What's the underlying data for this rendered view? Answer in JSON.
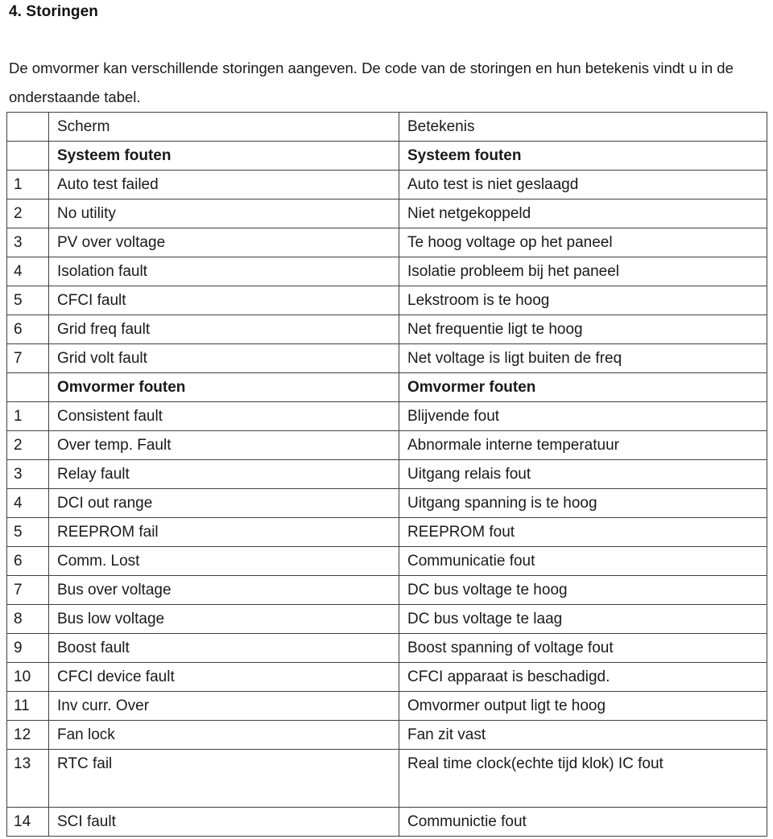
{
  "heading": "4. Storingen",
  "intro": "De omvormer kan verschillende storingen aangeven. De code van de storingen en hun betekenis vindt u in de onderstaande tabel.",
  "table": {
    "columns": {
      "num": "",
      "scherm": "Scherm",
      "betekenis": "Betekenis"
    },
    "rows": [
      {
        "num": "",
        "scherm": "Scherm",
        "betekenis": "Betekenis",
        "section": false,
        "tall": false
      },
      {
        "num": "",
        "scherm": "Systeem fouten",
        "betekenis": "Systeem fouten",
        "section": true,
        "tall": false
      },
      {
        "num": "1",
        "scherm": "Auto test failed",
        "betekenis": "Auto test is niet geslaagd",
        "section": false,
        "tall": false
      },
      {
        "num": "2",
        "scherm": "No utility",
        "betekenis": "Niet netgekoppeld",
        "section": false,
        "tall": false
      },
      {
        "num": "3",
        "scherm": "PV over voltage",
        "betekenis": "Te hoog voltage op het paneel",
        "section": false,
        "tall": false
      },
      {
        "num": "4",
        "scherm": "Isolation fault",
        "betekenis": "Isolatie probleem bij het paneel",
        "section": false,
        "tall": false
      },
      {
        "num": "5",
        "scherm": "CFCI fault",
        "betekenis": "Lekstroom is te hoog",
        "section": false,
        "tall": false
      },
      {
        "num": "6",
        "scherm": "Grid freq fault",
        "betekenis": "Net frequentie ligt te hoog",
        "section": false,
        "tall": false
      },
      {
        "num": "7",
        "scherm": "Grid volt fault",
        "betekenis": "Net voltage is ligt buiten de freq",
        "section": false,
        "tall": false
      },
      {
        "num": "",
        "scherm": "Omvormer fouten",
        "betekenis": "Omvormer fouten",
        "section": true,
        "tall": false
      },
      {
        "num": "1",
        "scherm": "Consistent fault",
        "betekenis": "Blijvende fout",
        "section": false,
        "tall": false
      },
      {
        "num": "2",
        "scherm": "Over temp. Fault",
        "betekenis": "Abnormale interne temperatuur",
        "section": false,
        "tall": false
      },
      {
        "num": "3",
        "scherm": "Relay fault",
        "betekenis": "Uitgang relais fout",
        "section": false,
        "tall": false
      },
      {
        "num": "4",
        "scherm": "DCI out range",
        "betekenis": "Uitgang spanning is te hoog",
        "section": false,
        "tall": false
      },
      {
        "num": "5",
        "scherm": "REEPROM fail",
        "betekenis": "REEPROM fout",
        "section": false,
        "tall": false
      },
      {
        "num": "6",
        "scherm": "Comm. Lost",
        "betekenis": "Communicatie fout",
        "section": false,
        "tall": false
      },
      {
        "num": "7",
        "scherm": "Bus over voltage",
        "betekenis": "DC bus voltage te hoog",
        "section": false,
        "tall": false
      },
      {
        "num": "8",
        "scherm": "Bus low voltage",
        "betekenis": "DC bus voltage te laag",
        "section": false,
        "tall": false
      },
      {
        "num": "9",
        "scherm": "Boost fault",
        "betekenis": "Boost spanning of voltage fout",
        "section": false,
        "tall": false
      },
      {
        "num": "10",
        "scherm": "CFCI device fault",
        "betekenis": "CFCI apparaat is beschadigd.",
        "section": false,
        "tall": false
      },
      {
        "num": "11",
        "scherm": "Inv curr. Over",
        "betekenis": "Omvormer output ligt te hoog",
        "section": false,
        "tall": false
      },
      {
        "num": "12",
        "scherm": "Fan lock",
        "betekenis": "Fan zit vast",
        "section": false,
        "tall": false
      },
      {
        "num": "13",
        "scherm": "RTC fail",
        "betekenis": "Real time clock(echte tijd klok) IC fout",
        "section": false,
        "tall": true
      },
      {
        "num": "14",
        "scherm": "SCI fault",
        "betekenis": "Communictie fout",
        "section": false,
        "tall": false
      }
    ]
  }
}
